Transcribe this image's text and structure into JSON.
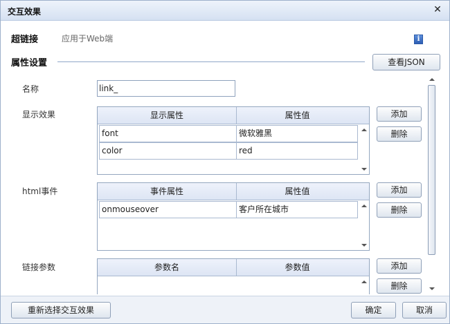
{
  "dialog": {
    "title": "交互效果"
  },
  "hyperlink": {
    "title": "超链接",
    "subtitle": "应用于Web端"
  },
  "attributes": {
    "title": "属性设置",
    "view_json_label": "查看JSON"
  },
  "name_field": {
    "label": "名称",
    "value": "link_"
  },
  "display_effect": {
    "label": "显示效果",
    "columns": [
      "显示属性",
      "属性值"
    ],
    "rows": [
      {
        "key": "font",
        "value": "微软雅黑"
      },
      {
        "key": "color",
        "value": "red"
      }
    ],
    "add_label": "添加",
    "delete_label": "删除"
  },
  "html_events": {
    "label": "html事件",
    "columns": [
      "事件属性",
      "属性值"
    ],
    "rows": [
      {
        "key": "onmouseover",
        "value": "客户所在城市"
      }
    ],
    "add_label": "添加",
    "delete_label": "删除"
  },
  "link_params": {
    "label": "链接参数",
    "columns": [
      "参数名",
      "参数值"
    ],
    "add_label": "添加",
    "delete_label": "删除"
  },
  "footer": {
    "reselect_label": "重新选择交互效果",
    "ok_label": "确定",
    "cancel_label": "取消"
  },
  "icons": {
    "close": "close-icon",
    "info": "info-icon"
  }
}
